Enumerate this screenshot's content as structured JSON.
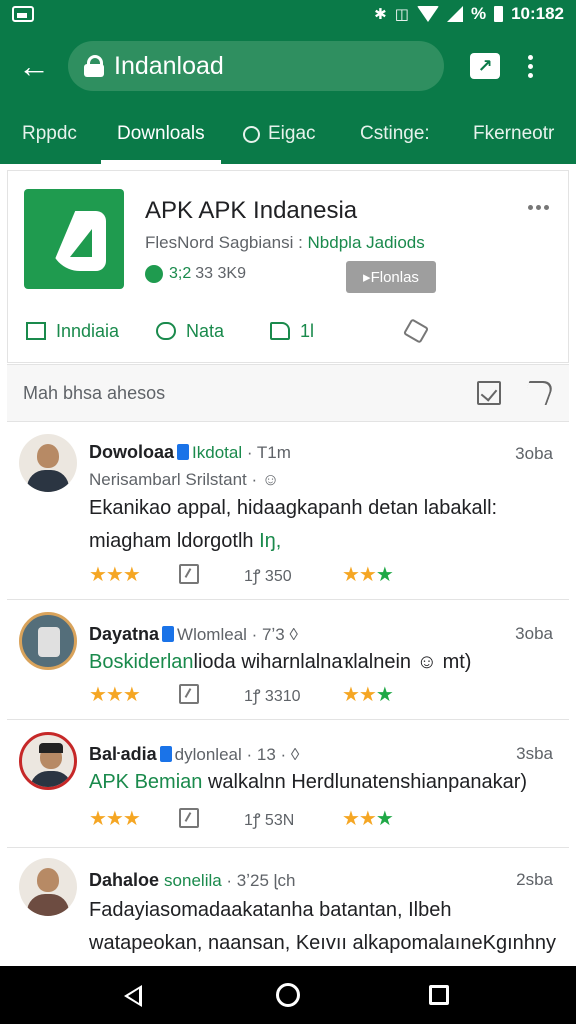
{
  "status_bar": {
    "time": "10:182",
    "battery_text": "%"
  },
  "app_bar": {
    "url": "Indanload"
  },
  "tabs": [
    {
      "label": "Rppdc"
    },
    {
      "label": "Downloals"
    },
    {
      "label": "Eigac"
    },
    {
      "label": "Cstinge:"
    },
    {
      "label": "Fkerneotr"
    }
  ],
  "app": {
    "title": "APK APK Indanesia",
    "subtitle_a": "FlesNord Sagbiansi : ",
    "subtitle_b": "Nbdpla Jadiods",
    "rating": "3;2",
    "size": "33 3K9",
    "install_label": "Flonlas",
    "actions": {
      "download": "Inndiaia",
      "comment": "Nata",
      "like": "1l"
    }
  },
  "reviews_section": {
    "title": "Mah bhsa ahesos"
  },
  "reviews": [
    {
      "name": "Dowoloaa",
      "tag": "Ikdotal",
      "time": " · T1m",
      "date": "3oba",
      "sub": "Nerisambarl Srilstant · ",
      "text_a": "Ekanikao appal, hidaagkapanh detan labakall: miagham ldorgotlh ",
      "text_b": "Iŋ,",
      "retweets": "1ꝭ 350",
      "stars_left": "★★★",
      "stars_right_y": "★★",
      "stars_right_g": "★"
    },
    {
      "name": "Dayatna",
      "tag": "Wlomleal · 7ʼ3",
      "time": " ◊",
      "date": "3oba",
      "sub": "",
      "text_a": "Boskiderlan",
      "text_b": "lioda wiharnlalnaҡlalnein ☺ mt)",
      "retweets": "1ꝭ 3310",
      "stars_left": "★★★",
      "stars_right_y": "★★",
      "stars_right_g": "★"
    },
    {
      "name": "Baŀadia",
      "tag": "dylonleal · 13 ·",
      "time": " ◊",
      "date": "3sba",
      "sub": "",
      "text_a": "APK Bemian ",
      "text_b": "walkalnn Herdlunatenshianpanakar)",
      "retweets": "1ꝭ 53N",
      "stars_left": "★★★",
      "stars_right_y": "★★",
      "stars_right_g": "★"
    },
    {
      "name": "Dahaloe",
      "tag": "sonelila",
      "time": " · 3ʼ25 ɭch",
      "date": "2sba",
      "sub": "",
      "text_a": "Fadayiasomadaakatanha batantan, Ilbeh watapeokan, naansan, Keıvıı alkapomalaıneKgınhny ☺ mó ☺",
      "text_b": "",
      "retweets": "",
      "stars_left": "",
      "stars_right_y": "",
      "stars_right_g": ""
    }
  ],
  "colors": {
    "primary": "#0a7a48",
    "accent_green": "#1a8a4c",
    "star": "#f5a623"
  }
}
